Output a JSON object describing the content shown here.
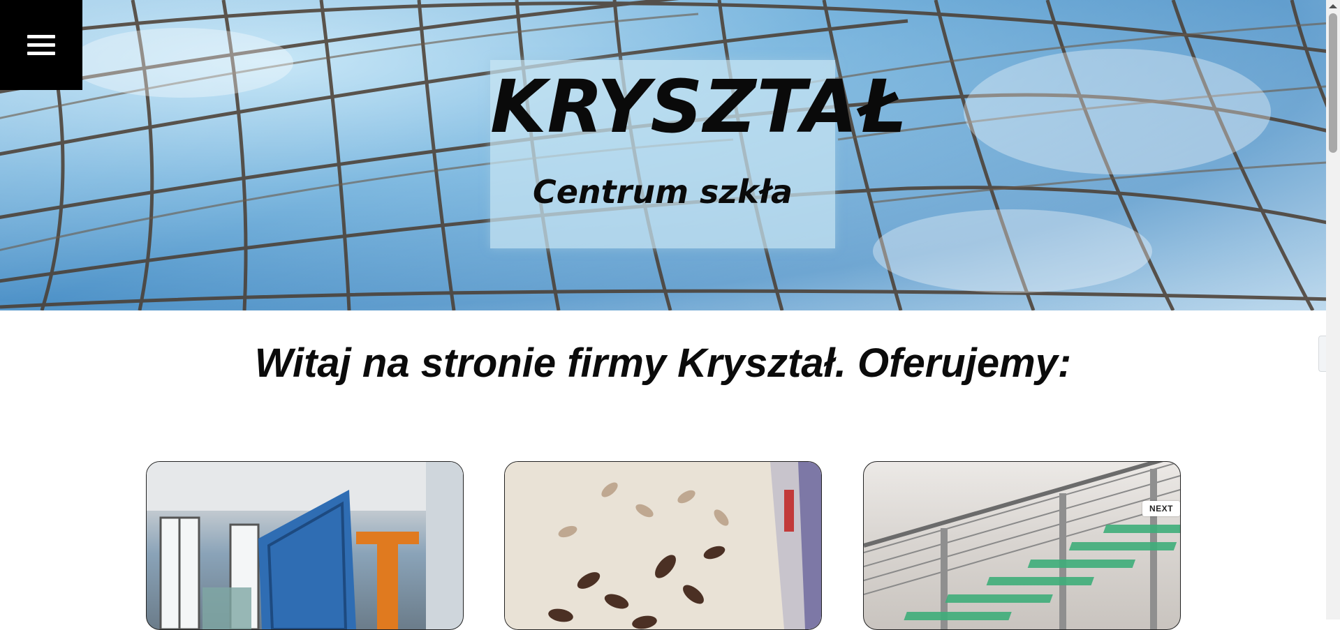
{
  "hero": {
    "menu_icon": "hamburger-menu-icon",
    "logo_title": "KRYSZTAŁ",
    "logo_subtitle": "Centrum szkła"
  },
  "main": {
    "welcome_heading": "Witaj na stronie firmy Kryształ. Oferujemy:"
  },
  "cards": [
    {
      "image": "glass-processing-workshop"
    },
    {
      "image": "decorative-frosted-glass-leaves"
    },
    {
      "image": "glass-staircase-with-steel-railing"
    }
  ],
  "slider": {
    "next_label": "NEXT"
  },
  "side_panel": {
    "toggle_glyph": "‹"
  },
  "colors": {
    "menu_bg": "#000000",
    "logo_box": "#c8e4f2",
    "link_blue": "#1f6fb6"
  }
}
